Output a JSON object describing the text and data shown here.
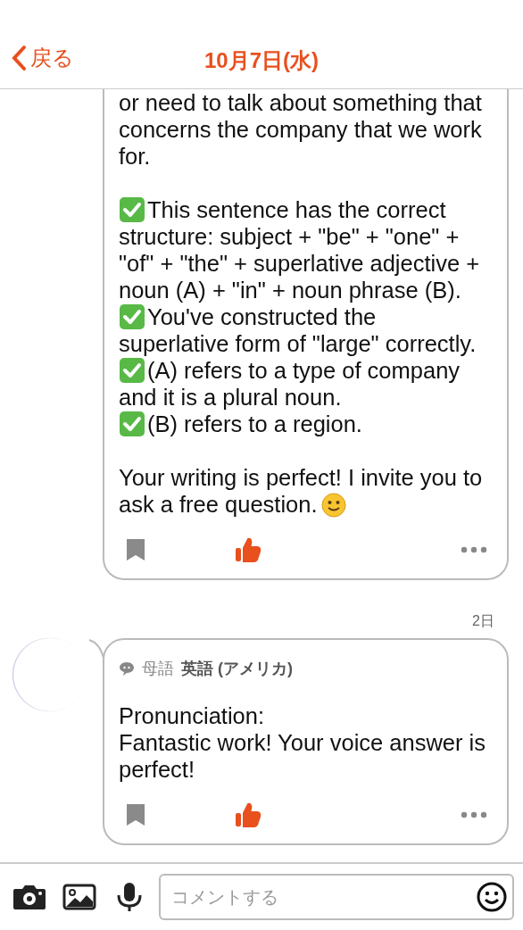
{
  "header": {
    "back": "戻る",
    "title": "10月7日(水)"
  },
  "comments": [
    {
      "kind": "cut",
      "liked": true,
      "blocks": [
        {
          "kind": "text",
          "text": "or need to talk about something that concerns the company that we work for."
        },
        {
          "kind": "gap"
        },
        {
          "kind": "check",
          "text": "This sentence has the correct structure: subject + \"be\" + \"one\" + \"of\" + \"the\" + superlative adjective + noun (A) + \"in\" + noun phrase (B)."
        },
        {
          "kind": "check",
          "text": "You've constructed the superlative form of \"large\" correctly."
        },
        {
          "kind": "check",
          "text": "(A) refers to a type of company and it is a plural noun."
        },
        {
          "kind": "check",
          "text": "(B) refers to a region."
        },
        {
          "kind": "gap"
        },
        {
          "kind": "smile",
          "text": "Your writing is perfect! I invite you to ask a free question."
        }
      ]
    },
    {
      "kind": "full",
      "age": "2日",
      "native_label": "母語",
      "native_language": "英語 (アメリカ)",
      "liked": true,
      "blocks": [
        {
          "kind": "text",
          "text": "Pronunciation:"
        },
        {
          "kind": "text",
          "text": "Fantastic work! Your voice answer is perfect!"
        }
      ]
    }
  ],
  "composer": {
    "placeholder": "コメントする"
  }
}
